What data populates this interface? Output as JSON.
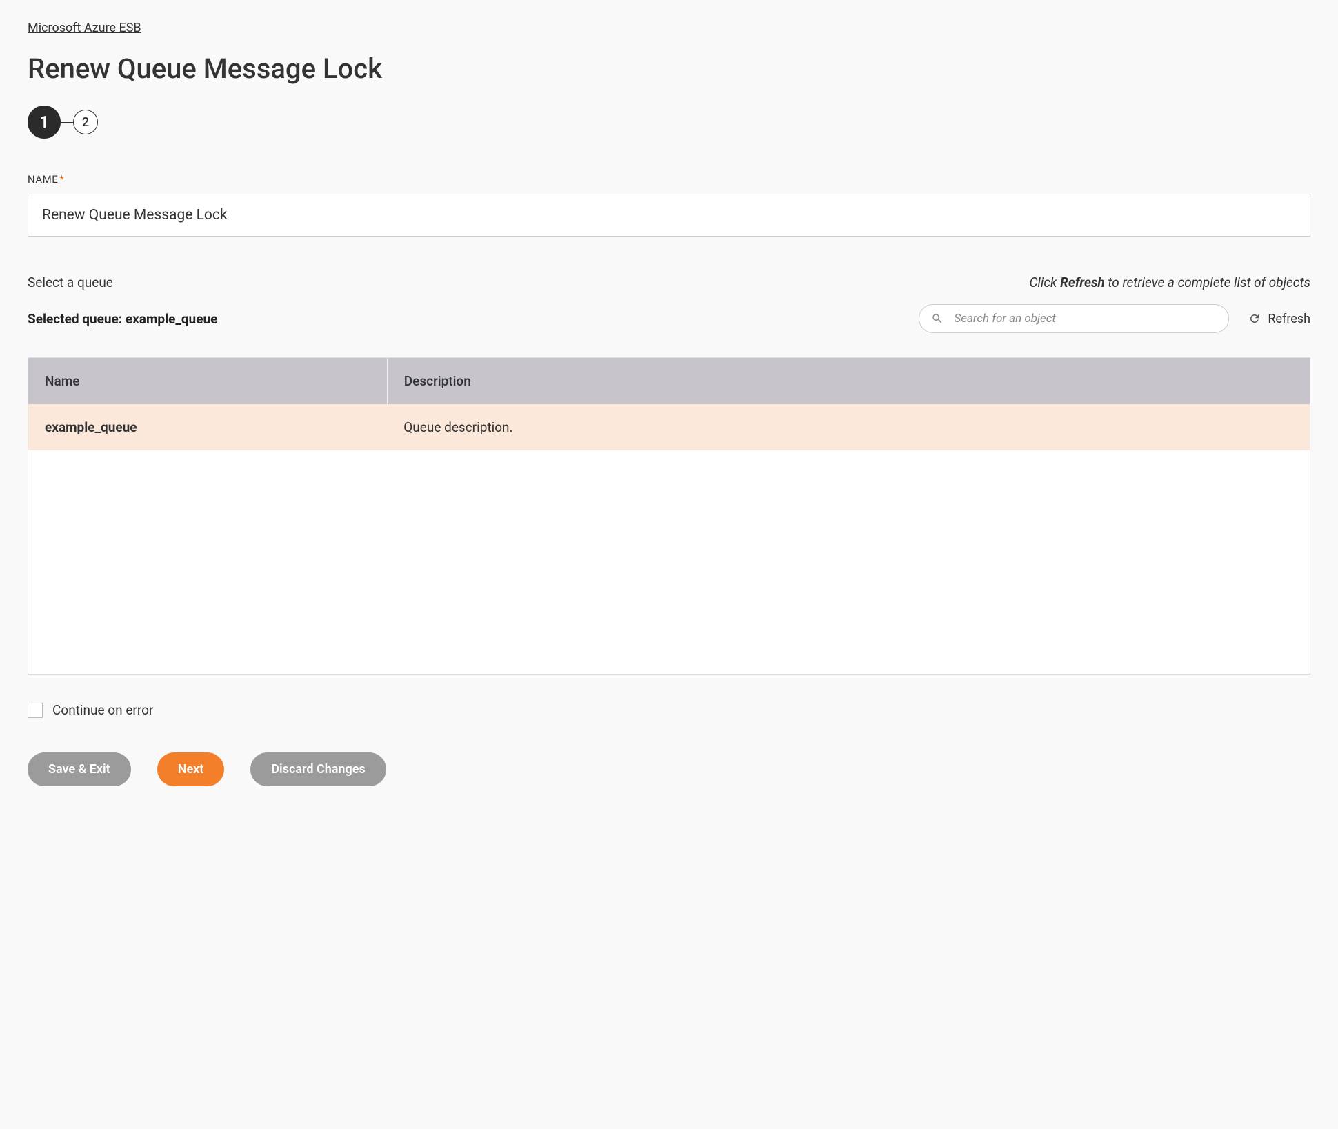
{
  "breadcrumb": "Microsoft Azure ESB",
  "page_title": "Renew Queue Message Lock",
  "stepper": {
    "step1": "1",
    "step2": "2"
  },
  "name_field": {
    "label": "NAME",
    "required_marker": "*",
    "value": "Renew Queue Message Lock"
  },
  "queue_section": {
    "select_label": "Select a queue",
    "refresh_hint_prefix": "Click ",
    "refresh_hint_bold": "Refresh",
    "refresh_hint_suffix": " to retrieve a complete list of objects",
    "selected_prefix": "Selected queue: ",
    "selected_value": "example_queue",
    "search_placeholder": "Search for an object",
    "refresh_label": "Refresh"
  },
  "table": {
    "headers": {
      "name": "Name",
      "description": "Description"
    },
    "rows": [
      {
        "name": "example_queue",
        "description": "Queue description."
      }
    ]
  },
  "continue_on_error_label": "Continue on error",
  "buttons": {
    "save_exit": "Save & Exit",
    "next": "Next",
    "discard": "Discard Changes"
  }
}
